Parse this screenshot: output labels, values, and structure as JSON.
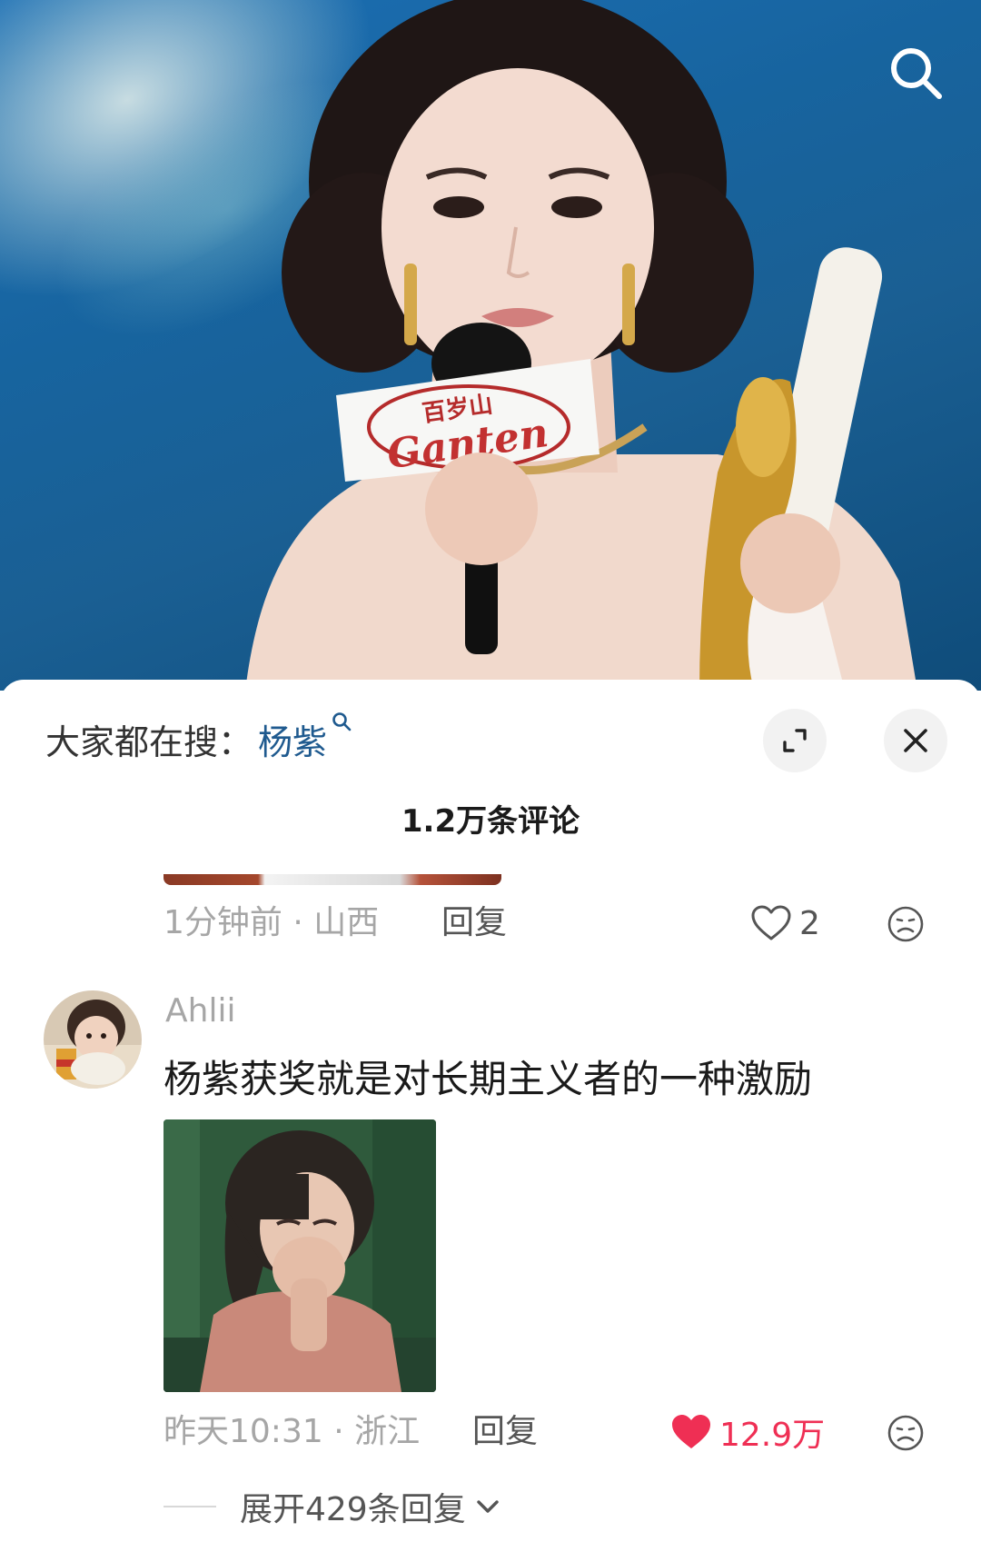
{
  "video": {
    "mic_logo_top": "百岁山",
    "mic_logo_brand": "Ganten",
    "search_icon": "search-icon"
  },
  "hot_search": {
    "prefix": "大家都在搜：",
    "keyword": "杨紫",
    "keyword_icon": "search-small-icon"
  },
  "header": {
    "comment_count": "1.2万条评论",
    "expand_icon": "expand-icon",
    "close_icon": "close-icon"
  },
  "comments": [
    {
      "meta": "1分钟前 · 山西",
      "reply_label": "回复",
      "likes": "2",
      "liked": false
    },
    {
      "username": "Ahlii",
      "text": "杨紫获奖就是对长期主义者的一种激励",
      "meta": "昨天10:31 · 浙江",
      "reply_label": "回复",
      "likes": "12.9万",
      "liked": true,
      "expand_replies": "展开429条回复"
    }
  ],
  "colors": {
    "keyword": "#1f5a8f",
    "like_active": "#ef2f54",
    "muted": "#a6a6a6"
  }
}
